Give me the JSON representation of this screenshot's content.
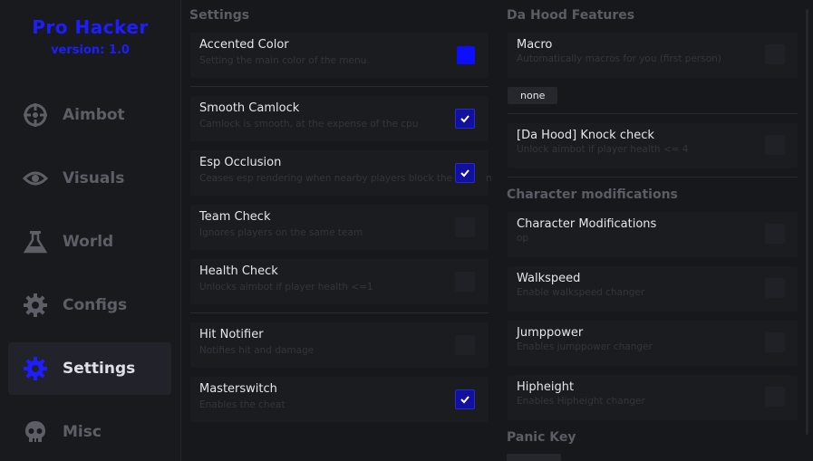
{
  "brand": {
    "title": "Pro Hacker",
    "version": "version: 1.0"
  },
  "colors": {
    "accent": "#1d1dff",
    "check_on": "#11119e"
  },
  "nav": [
    {
      "label": "Aimbot",
      "icon": "crosshair-icon"
    },
    {
      "label": "Visuals",
      "icon": "eye-icon"
    },
    {
      "label": "World",
      "icon": "flask-icon"
    },
    {
      "label": "Configs",
      "icon": "cog-icon"
    },
    {
      "label": "Settings",
      "icon": "cog-icon",
      "active": true
    },
    {
      "label": "Misc",
      "icon": "skull-icon"
    }
  ],
  "settings": {
    "title": "Settings",
    "rows": [
      {
        "title": "Accented Color",
        "desc": "Setting the main color of the menu.",
        "control": "color"
      },
      {
        "title": "Smooth Camlock",
        "desc": "Camlock is smooth, at the expense of the cpu",
        "checked": true
      },
      {
        "title": "Esp Occlusion",
        "desc": "Ceases esp rendering when nearby players block the",
        "extra": "n",
        "checked": true
      },
      {
        "title": "Team Check",
        "desc": "Ignores players on the same team",
        "checked": false
      },
      {
        "title": "Health Check",
        "desc": "Unlocks aimbot if player health <=1",
        "checked": false
      },
      {
        "title": "Hit Notifier",
        "desc": "Notifies hit and damage",
        "checked": false
      },
      {
        "title": "Masterswitch",
        "desc": "Enables the cheat",
        "checked": true
      }
    ]
  },
  "dahood": {
    "title": "Da Hood Features",
    "macro": {
      "title": "Macro",
      "desc": "Automatically macros for you (first person)",
      "checked": false
    },
    "macro_key": "none",
    "knock": {
      "title": "[Da Hood] Knock check",
      "desc": "Unlock aimbot if player health <= 4",
      "checked": false
    }
  },
  "character": {
    "title": "Character modifications",
    "rows": [
      {
        "title": "Character Modifications",
        "desc": "op",
        "checked": false
      },
      {
        "title": "Walkspeed",
        "desc": "Enable walkspeed changer",
        "checked": false
      },
      {
        "title": "Jumppower",
        "desc": "Enables jumppower changer",
        "checked": false
      },
      {
        "title": "Hipheight",
        "desc": "Enables Hipheight changer",
        "checked": false
      }
    ]
  },
  "panic": {
    "title": "Panic Key"
  }
}
